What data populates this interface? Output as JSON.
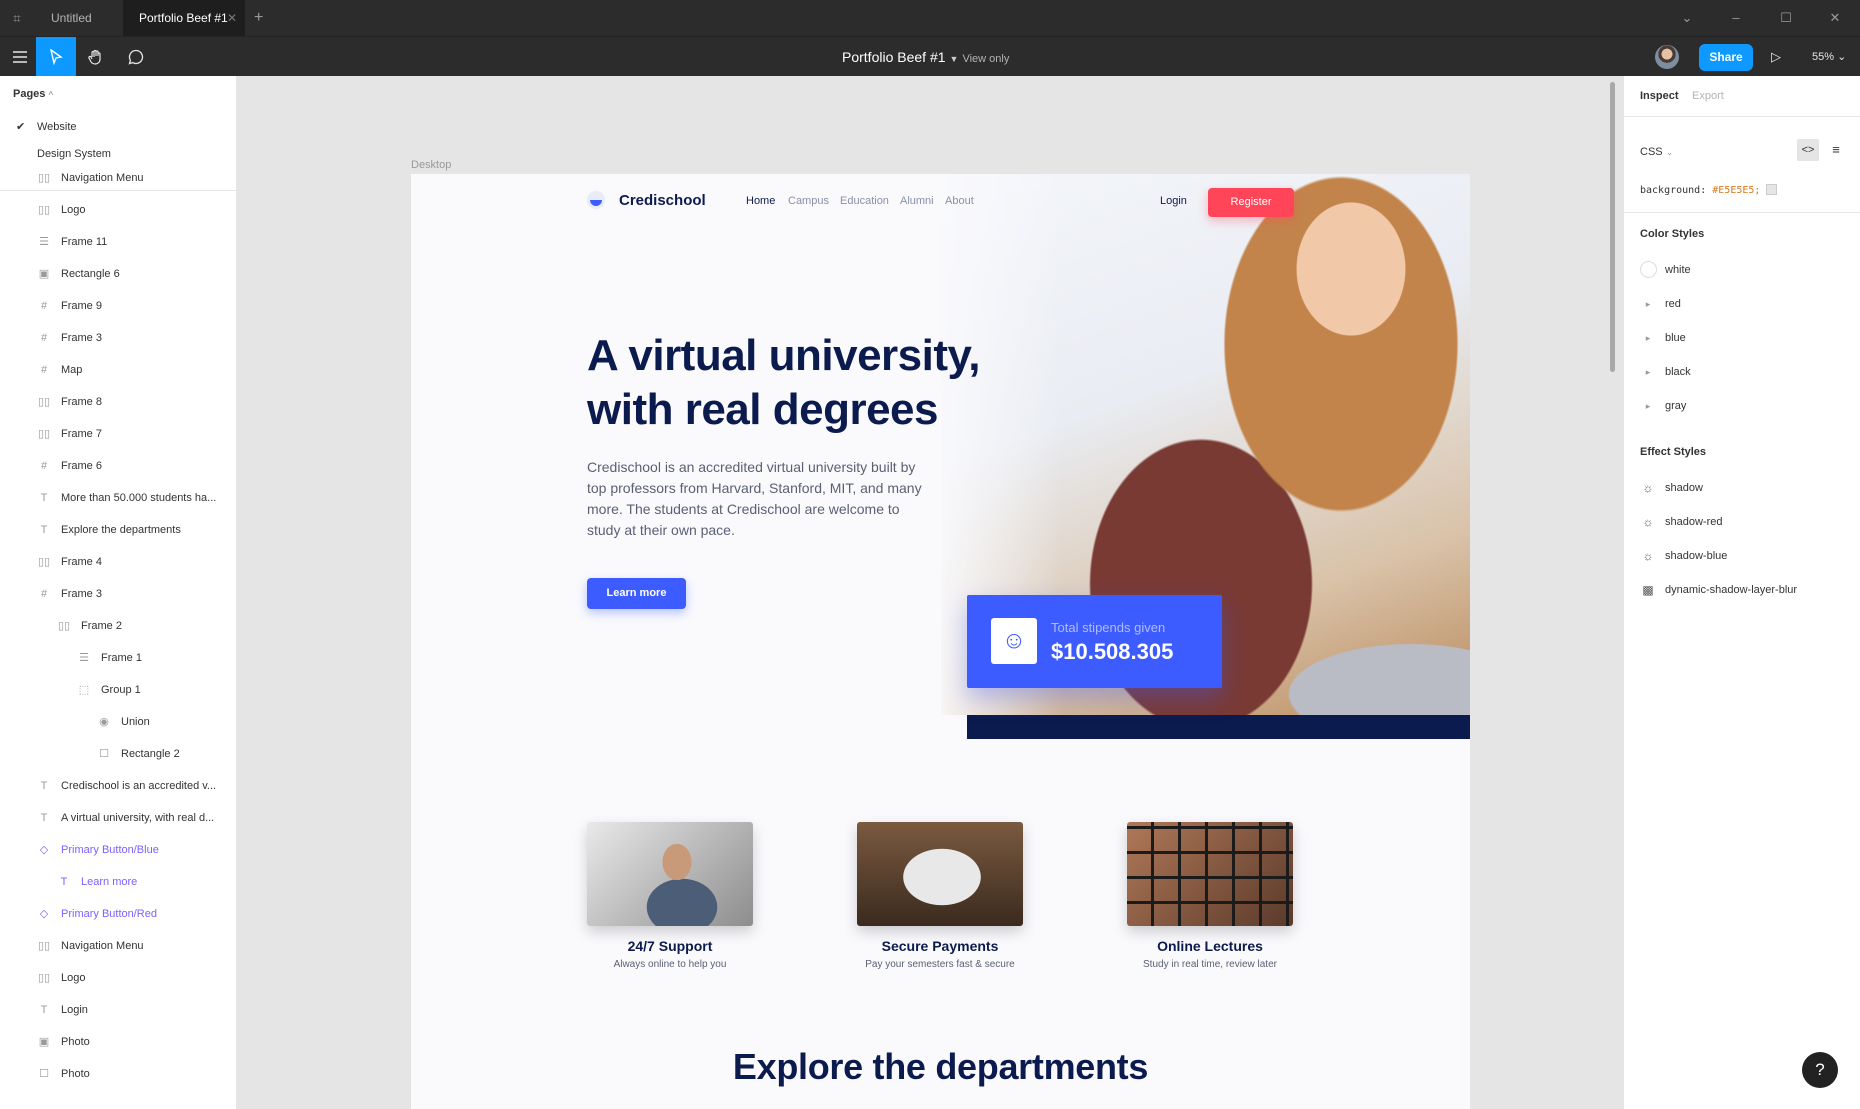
{
  "titlebar": {
    "tabs": [
      {
        "label": "Untitled"
      },
      {
        "label": "Portfolio Beef #1"
      }
    ]
  },
  "toolbar": {
    "doc_title": "Portfolio Beef #1",
    "view_mode": "View only",
    "share_label": "Share",
    "zoom": "55%"
  },
  "left": {
    "pages_label": "Pages",
    "pages": [
      "Website",
      "Design System"
    ],
    "layers": [
      {
        "label": "Navigation Menu",
        "icon": "auto-layout-h-icon",
        "indent": 0
      },
      {
        "label": "Logo",
        "icon": "auto-layout-h-icon",
        "indent": 0
      },
      {
        "label": "Frame 11",
        "icon": "auto-layout-v-icon",
        "indent": 0
      },
      {
        "label": "Rectangle 6",
        "icon": "image-icon",
        "indent": 0
      },
      {
        "label": "Frame 9",
        "icon": "frame-icon",
        "indent": 0
      },
      {
        "label": "Frame 3",
        "icon": "frame-icon",
        "indent": 0
      },
      {
        "label": "Map",
        "icon": "frame-icon",
        "indent": 0
      },
      {
        "label": "Frame 8",
        "icon": "auto-layout-h-icon",
        "indent": 0
      },
      {
        "label": "Frame 7",
        "icon": "auto-layout-h-icon",
        "indent": 0
      },
      {
        "label": "Frame 6",
        "icon": "frame-icon",
        "indent": 0
      },
      {
        "label": "More than 50.000 students ha...",
        "icon": "text-icon",
        "indent": 0
      },
      {
        "label": "Explore the departments",
        "icon": "text-icon",
        "indent": 0
      },
      {
        "label": "Frame 4",
        "icon": "auto-layout-h-icon",
        "indent": 0
      },
      {
        "label": "Frame 3",
        "icon": "frame-icon",
        "indent": 0
      },
      {
        "label": "Frame 2",
        "icon": "auto-layout-h-icon",
        "indent": 1
      },
      {
        "label": "Frame 1",
        "icon": "auto-layout-v-icon",
        "indent": 2
      },
      {
        "label": "Group 1",
        "icon": "group-icon",
        "indent": 2
      },
      {
        "label": "Union",
        "icon": "union-icon",
        "indent": 3
      },
      {
        "label": "Rectangle 2",
        "icon": "rectangle-icon",
        "indent": 3
      },
      {
        "label": "Credischool is an accredited v...",
        "icon": "text-icon",
        "indent": 0
      },
      {
        "label": "A virtual university, with real d...",
        "icon": "text-icon",
        "indent": 0
      },
      {
        "label": "Primary Button/Blue",
        "icon": "component-instance-icon",
        "indent": 0,
        "kind": "comp"
      },
      {
        "label": "Learn more",
        "icon": "text-icon",
        "indent": 1,
        "kind": "comp"
      },
      {
        "label": "Primary Button/Red",
        "icon": "component-instance-icon",
        "indent": 0,
        "kind": "comp"
      },
      {
        "label": "Navigation Menu",
        "icon": "auto-layout-h-icon",
        "indent": 0
      },
      {
        "label": "Logo",
        "icon": "auto-layout-h-icon",
        "indent": 0
      },
      {
        "label": "Login",
        "icon": "text-icon",
        "indent": 0
      },
      {
        "label": "Photo",
        "icon": "image-icon",
        "indent": 0
      },
      {
        "label": "Photo",
        "icon": "rectangle-icon",
        "indent": 0
      }
    ]
  },
  "canvas": {
    "frame_label": "Desktop",
    "site": {
      "brand": "Credischool",
      "nav": [
        "Home",
        "Campus",
        "Education",
        "Alumni",
        "About"
      ],
      "login": "Login",
      "register": "Register",
      "headline": "A virtual university, with real degrees",
      "lead": "Credischool is an accredited virtual university built by top professors from Harvard, Stanford, MIT, and many more. The students at Credischool are welcome to study at their own pace.",
      "learn_more": "Learn more",
      "stipend_label": "Total stipends given",
      "stipend_value": "$10.508.305",
      "features": [
        {
          "title": "24/7 Support",
          "subtitle": "Always online to help you"
        },
        {
          "title": "Secure Payments",
          "subtitle": "Pay your semesters fast & secure"
        },
        {
          "title": "Online Lectures",
          "subtitle": "Study in real time, review later"
        }
      ],
      "explore": "Explore the departments"
    }
  },
  "right": {
    "tabs": [
      "Inspect",
      "Export"
    ],
    "lang": "CSS",
    "css_prop": "background:",
    "css_value": "#E5E5E5;",
    "color_styles_title": "Color Styles",
    "color_styles": [
      "white",
      "red",
      "blue",
      "black",
      "gray"
    ],
    "effect_styles_title": "Effect Styles",
    "effect_styles": [
      "shadow",
      "shadow-red",
      "shadow-blue",
      "dynamic-shadow-layer-blur"
    ]
  },
  "help_label": "?"
}
